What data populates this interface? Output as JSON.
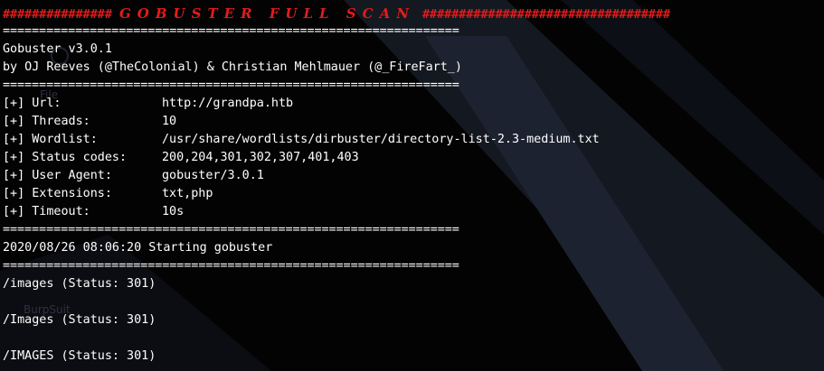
{
  "banner": {
    "left_hashes": "###############",
    "title": "GOBUSTER FULL SCAN",
    "right_hashes": "##################################"
  },
  "rule": "===============================================================",
  "header": {
    "version": "Gobuster v3.0.1",
    "authors": "by OJ Reeves (@TheColonial) & Christian Mehlmauer (@_FireFart_)"
  },
  "options": [
    {
      "label": "[+] Url:",
      "value": "http://grandpa.htb"
    },
    {
      "label": "[+] Threads:",
      "value": "10"
    },
    {
      "label": "[+] Wordlist:",
      "value": "/usr/share/wordlists/dirbuster/directory-list-2.3-medium.txt"
    },
    {
      "label": "[+] Status codes:",
      "value": "200,204,301,302,307,401,403"
    },
    {
      "label": "[+] User Agent:",
      "value": "gobuster/3.0.1"
    },
    {
      "label": "[+] Extensions:",
      "value": "txt,php"
    },
    {
      "label": "[+] Timeout:",
      "value": "10s"
    }
  ],
  "start_line": "2020/08/26 08:06:20 Starting gobuster",
  "results": [
    "/images (Status: 301)",
    "/Images (Status: 301)",
    "/IMAGES (Status: 301)"
  ],
  "ghost_text": {
    "file": "File",
    "burpsuite": "BurpSuit"
  },
  "colors": {
    "background": "#030303",
    "text": "#ffffff",
    "banner": "#e21c1c"
  }
}
